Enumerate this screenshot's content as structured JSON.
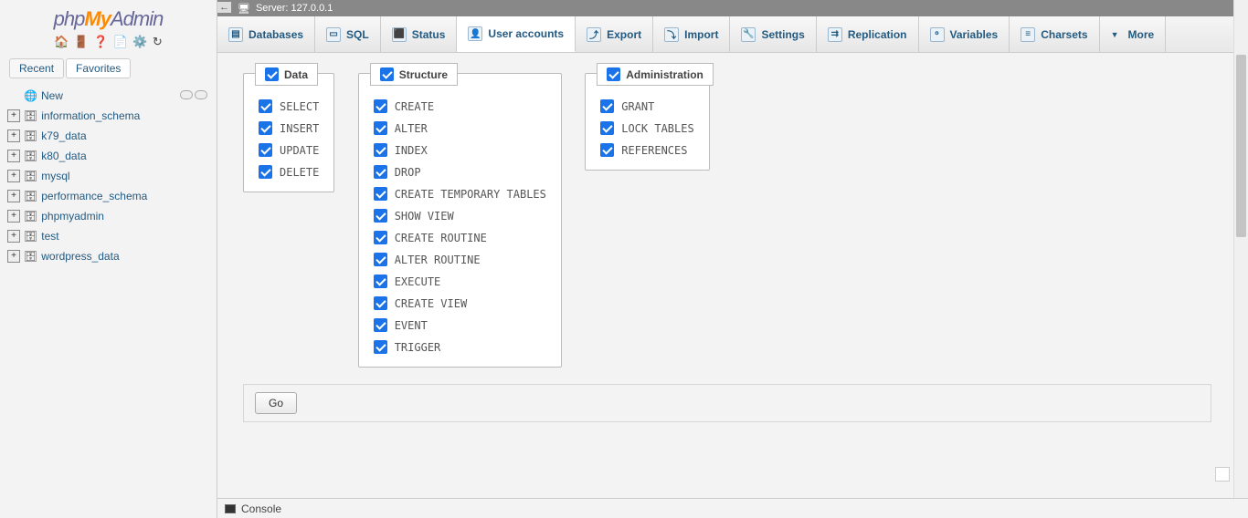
{
  "logo": {
    "p1": "php",
    "p2": "My",
    "p3": "Admin"
  },
  "sidebar": {
    "tabs": {
      "recent": "Recent",
      "favorites": "Favorites"
    },
    "new_label": "New",
    "dbs": [
      "information_schema",
      "k79_data",
      "k80_data",
      "mysql",
      "performance_schema",
      "phpmyadmin",
      "test",
      "wordpress_data"
    ]
  },
  "server": {
    "label": "Server: 127.0.0.1"
  },
  "nav": {
    "databases": "Databases",
    "sql": "SQL",
    "status": "Status",
    "user_accounts": "User accounts",
    "export": "Export",
    "import": "Import",
    "settings": "Settings",
    "replication": "Replication",
    "variables": "Variables",
    "charsets": "Charsets",
    "more": "More"
  },
  "privs": {
    "data": {
      "title": "Data",
      "items": [
        "SELECT",
        "INSERT",
        "UPDATE",
        "DELETE"
      ]
    },
    "structure": {
      "title": "Structure",
      "items": [
        "CREATE",
        "ALTER",
        "INDEX",
        "DROP",
        "CREATE TEMPORARY TABLES",
        "SHOW VIEW",
        "CREATE ROUTINE",
        "ALTER ROUTINE",
        "EXECUTE",
        "CREATE VIEW",
        "EVENT",
        "TRIGGER"
      ]
    },
    "admin": {
      "title": "Administration",
      "items": [
        "GRANT",
        "LOCK TABLES",
        "REFERENCES"
      ]
    }
  },
  "buttons": {
    "go": "Go"
  },
  "console": {
    "label": "Console"
  }
}
